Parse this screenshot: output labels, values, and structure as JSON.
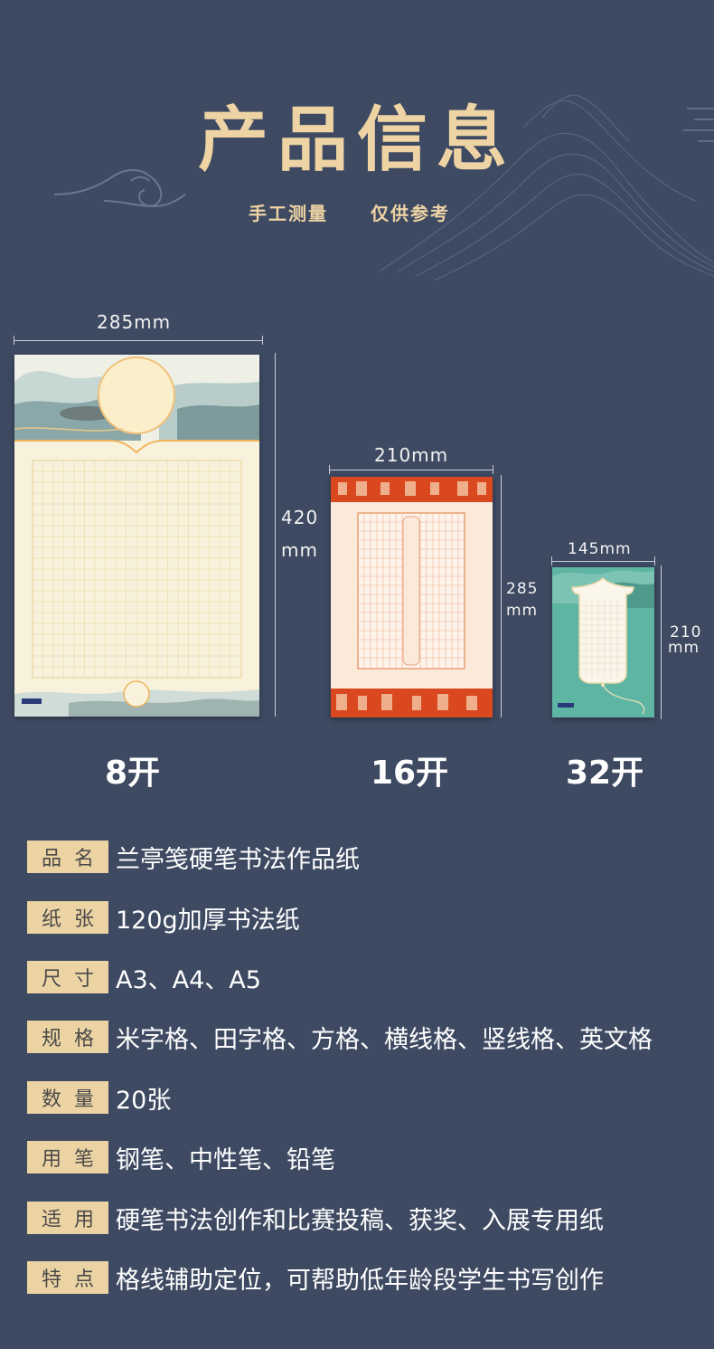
{
  "header": {
    "title": "产品信息",
    "subtitle_left": "手工测量",
    "subtitle_right": "仅供参考"
  },
  "papers": [
    {
      "size_label": "8开",
      "width": "285mm",
      "height_line1": "420",
      "height_line2": "mm"
    },
    {
      "size_label": "16开",
      "width": "210mm",
      "height_line1": "285",
      "height_line2": "mm"
    },
    {
      "size_label": "32开",
      "width": "145mm",
      "height_line1": "210",
      "height_line2": "mm"
    }
  ],
  "specs": [
    {
      "key": "品名",
      "value": "兰亭笺硬笔书法作品纸"
    },
    {
      "key": "纸张",
      "value": "120g加厚书法纸"
    },
    {
      "key": "尺寸",
      "value": "A3、A4、A5"
    },
    {
      "key": "规格",
      "value": "米字格、田字格、方格、横线格、竖线格、英文格"
    },
    {
      "key": "数量",
      "value": "20张"
    },
    {
      "key": "用笔",
      "value": "钢笔、中性笔、铅笔"
    },
    {
      "key": "适用",
      "value": "硬笔书法创作和比赛投稿、获奖、入展专用纸"
    },
    {
      "key": "特点",
      "value": "格线辅助定位，可帮助低年龄段学生书写创作"
    }
  ],
  "colors": {
    "background": "#3e4a62",
    "gold": "#eed3a4",
    "key_bg": "#ecd3a3",
    "red_band": "#d9481f",
    "teal": "#5fb5a4"
  }
}
